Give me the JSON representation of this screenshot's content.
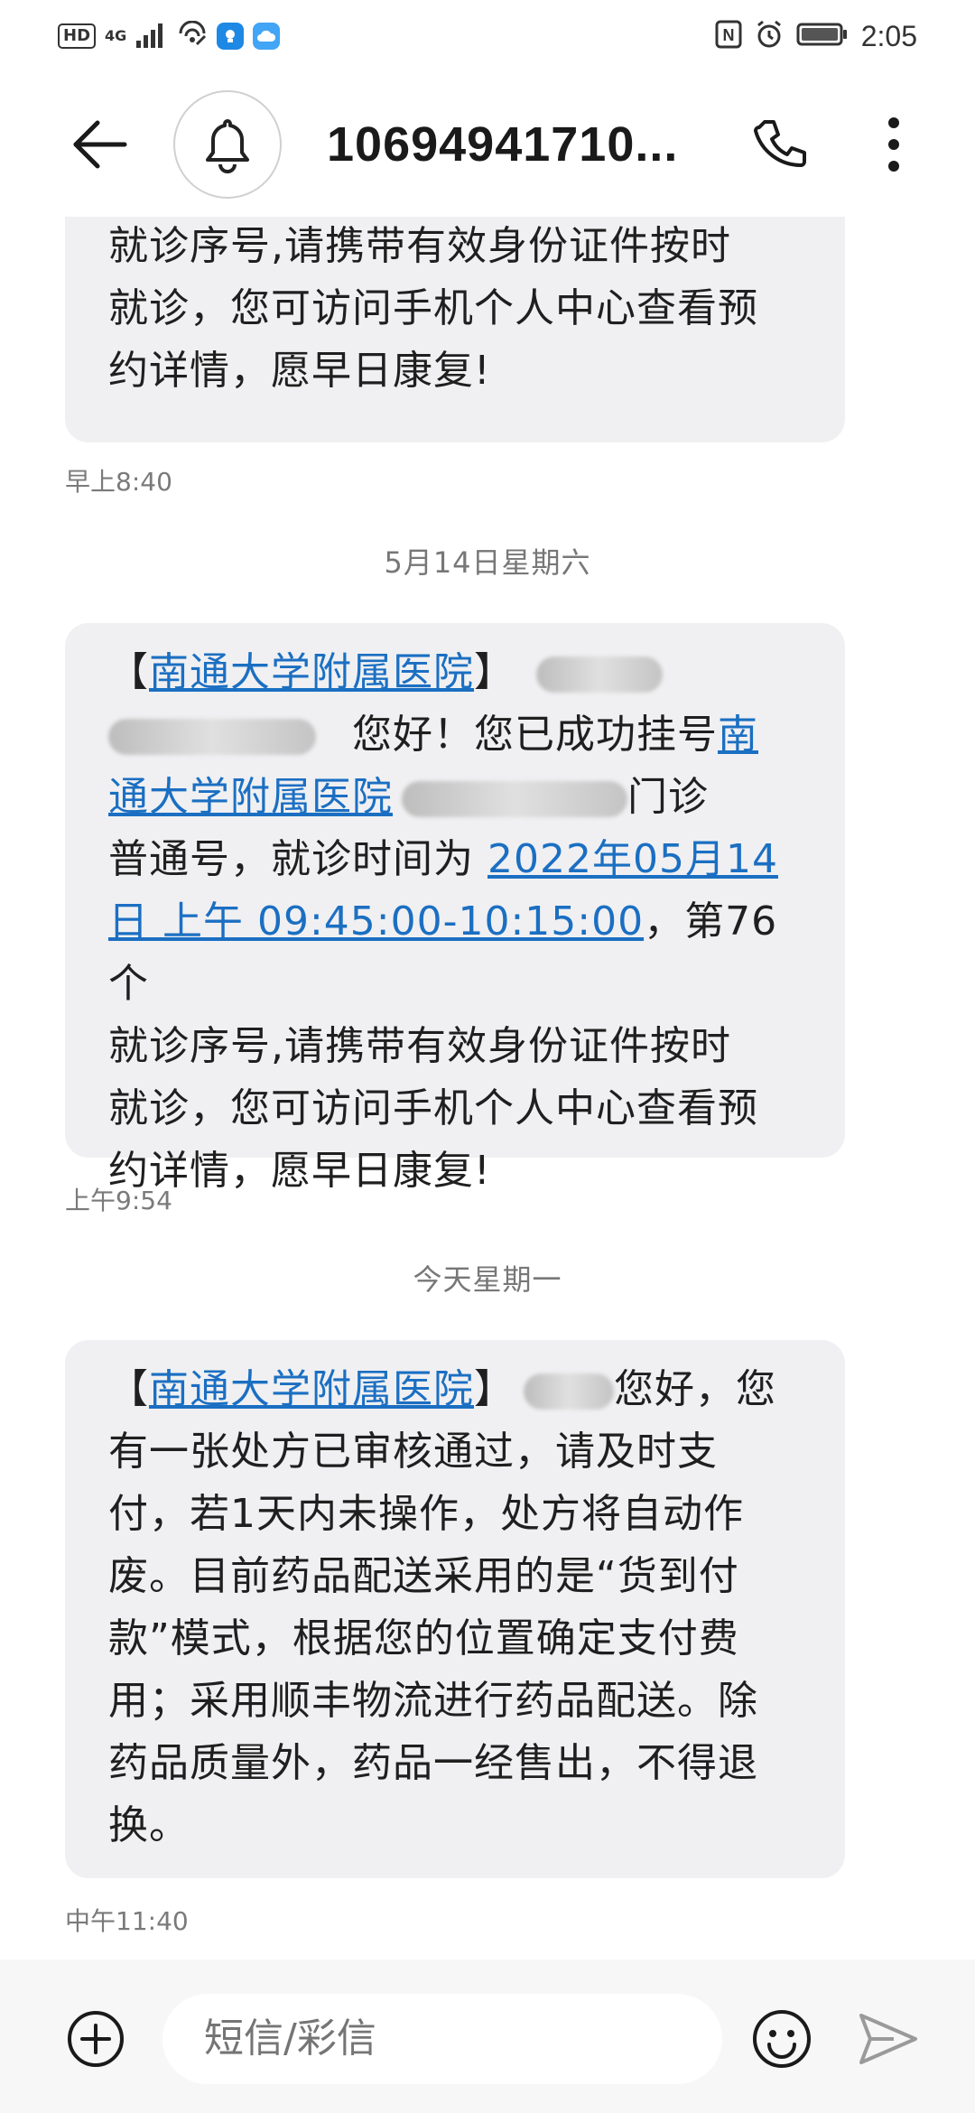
{
  "status_bar": {
    "hd": "HD",
    "network": "4G",
    "time": "2:05",
    "nfc": "N"
  },
  "header": {
    "title": "10694941710...",
    "back_icon": "back-arrow-icon",
    "avatar_icon": "bell-icon",
    "call_icon": "phone-icon",
    "more_icon": "more-vertical-icon"
  },
  "messages": {
    "msg1": {
      "line1": "就诊序号,请携带有效身份证件按时",
      "line2": "就诊，您可访问手机个人中心查看预",
      "line3": "约详情，愿早日康复!",
      "time": "早上8:40"
    },
    "date_sep1": "5月14日星期六",
    "msg2": {
      "bracket_open": "【",
      "hospital": "南通大学附属医院",
      "bracket_close": "】",
      "hello": "您好！您已成功挂号",
      "hospital_link_a": "南",
      "hospital_link_b": "通大学附属医院",
      "dept_tail": "门诊",
      "type_text": "普通号，就诊时间为 ",
      "date_link_a": "2022年05月14",
      "date_link_b": "日 上午  09:45:00-10:15:00",
      "seq_text": "，第76个",
      "line6": "就诊序号,请携带有效身份证件按时",
      "line7": "就诊，您可访问手机个人中心查看预",
      "line8": "约详情，愿早日康复!",
      "time": "上午9:54"
    },
    "date_sep2": "今天星期一",
    "msg3": {
      "bracket_open": "【",
      "hospital": "南通大学附属医院",
      "bracket_close": "】",
      "hello": "您好，您",
      "line2": "有一张处方已审核通过，请及时支",
      "line3": "付，若1天内未操作，处方将自动作",
      "line4": "废。目前药品配送采用的是“货到付",
      "line5": "款”模式，根据您的位置确定支付费",
      "line6": "用；采用顺丰物流进行药品配送。除",
      "line7": "药品质量外，药品一经售出，不得退",
      "line8": "换。",
      "time": "中午11:40"
    }
  },
  "composer": {
    "placeholder": "短信/彩信",
    "add_icon": "plus-circle-icon",
    "emoji_icon": "emoji-icon",
    "send_icon": "send-icon"
  },
  "colors": {
    "bubble": "#f0f0f2",
    "link": "#1b6fc2",
    "background": "#ffffff"
  }
}
